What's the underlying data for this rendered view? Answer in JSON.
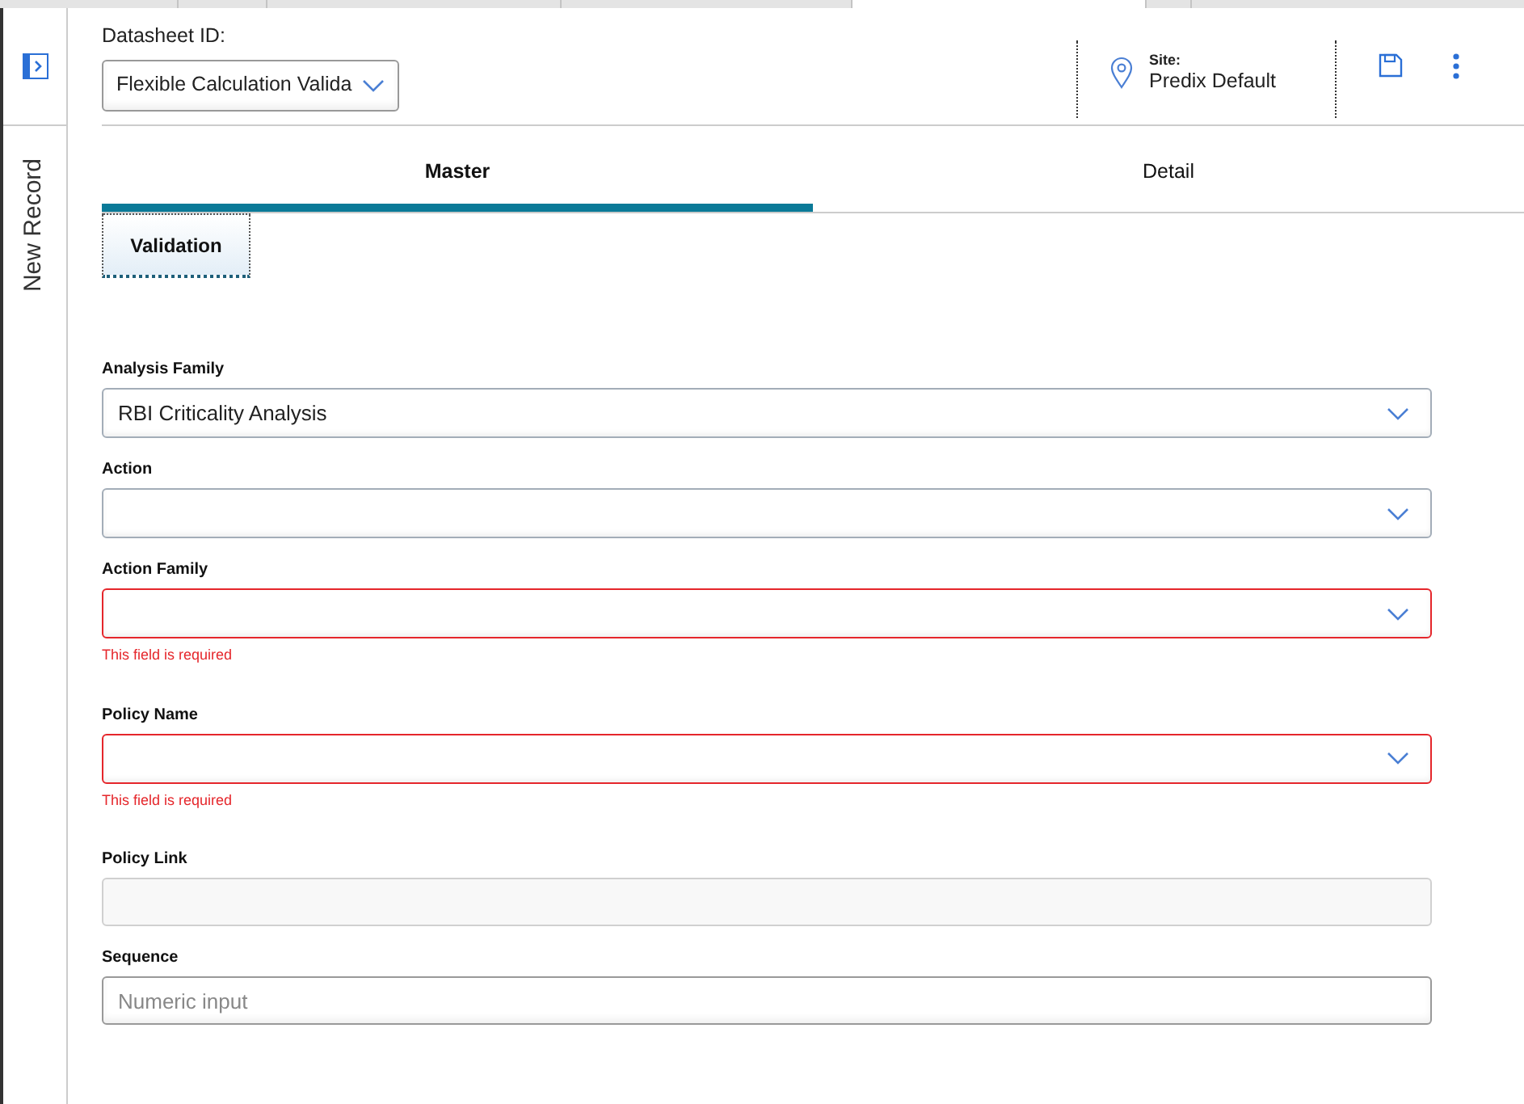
{
  "sidebar": {
    "label": "New Record"
  },
  "header": {
    "datasheet_label": "Datasheet ID:",
    "datasheet_value": "Flexible Calculation Valida",
    "site_label": "Site:",
    "site_value": "Predix Default"
  },
  "tabs": [
    {
      "label": "Master",
      "selected": true
    },
    {
      "label": "Detail",
      "selected": false
    }
  ],
  "subtabs": [
    {
      "label": "Validation",
      "selected": true
    }
  ],
  "fields": [
    {
      "label": "Analysis Family",
      "kind": "select",
      "value": "RBI Criticality Analysis",
      "invalid": false
    },
    {
      "label": "Action",
      "kind": "select",
      "invalid": false
    },
    {
      "label": "Action Family",
      "kind": "select",
      "invalid": true,
      "error": "This field is required"
    },
    {
      "label": "Policy Name",
      "kind": "select",
      "invalid": true,
      "error": "This field is required"
    },
    {
      "label": "Policy Link",
      "kind": "text",
      "disabled": true,
      "invalid": false
    },
    {
      "label": "Sequence",
      "kind": "text",
      "placeholder": "Numeric input",
      "disabled": false,
      "invalid": false
    }
  ]
}
